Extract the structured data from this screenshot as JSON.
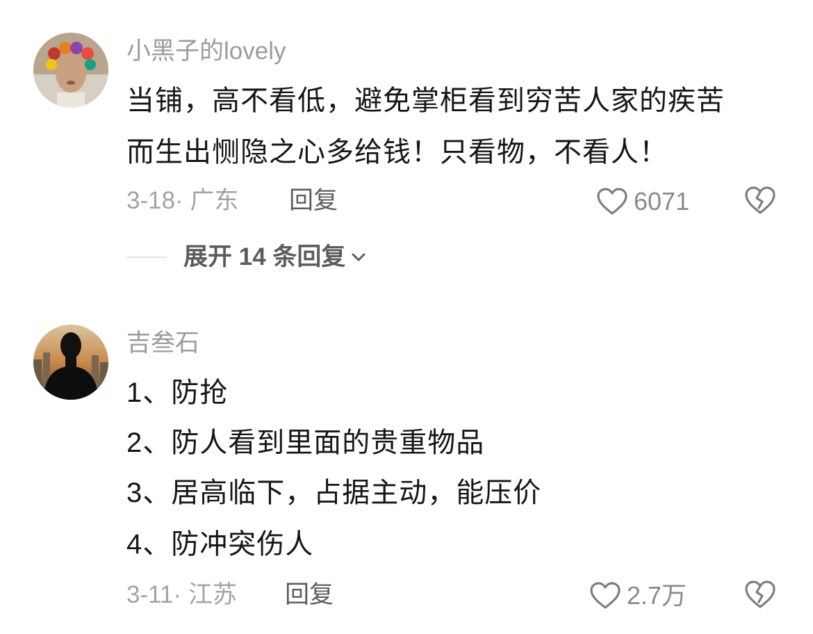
{
  "comments": [
    {
      "username": "小黑子的lovely",
      "lines": [
        "当铺，高不看低，避免掌柜看到穷苦人家的疾苦",
        "而生出恻隐之心多给钱！只看物，不看人！"
      ],
      "date_location": "3-18· 广东",
      "reply_label": "回复",
      "like_count": "6071",
      "expand_label": "展开 14 条回复"
    },
    {
      "username": "吉叁石",
      "lines": [
        "1、防抢",
        "2、防人看到里面的贵重物品",
        "3、居高临下，占据主动，能压价",
        "4、防冲突伤人"
      ],
      "date_location": "3-11· 江苏",
      "reply_label": "回复",
      "like_count": "2.7万"
    }
  ],
  "icons": {
    "like": "heart-outline-icon",
    "dislike": "broken-heart-icon",
    "expand": "chevron-down-icon"
  },
  "colors": {
    "text": "#161616",
    "muted": "#9b9b9b",
    "action": "#5c5c5c"
  }
}
